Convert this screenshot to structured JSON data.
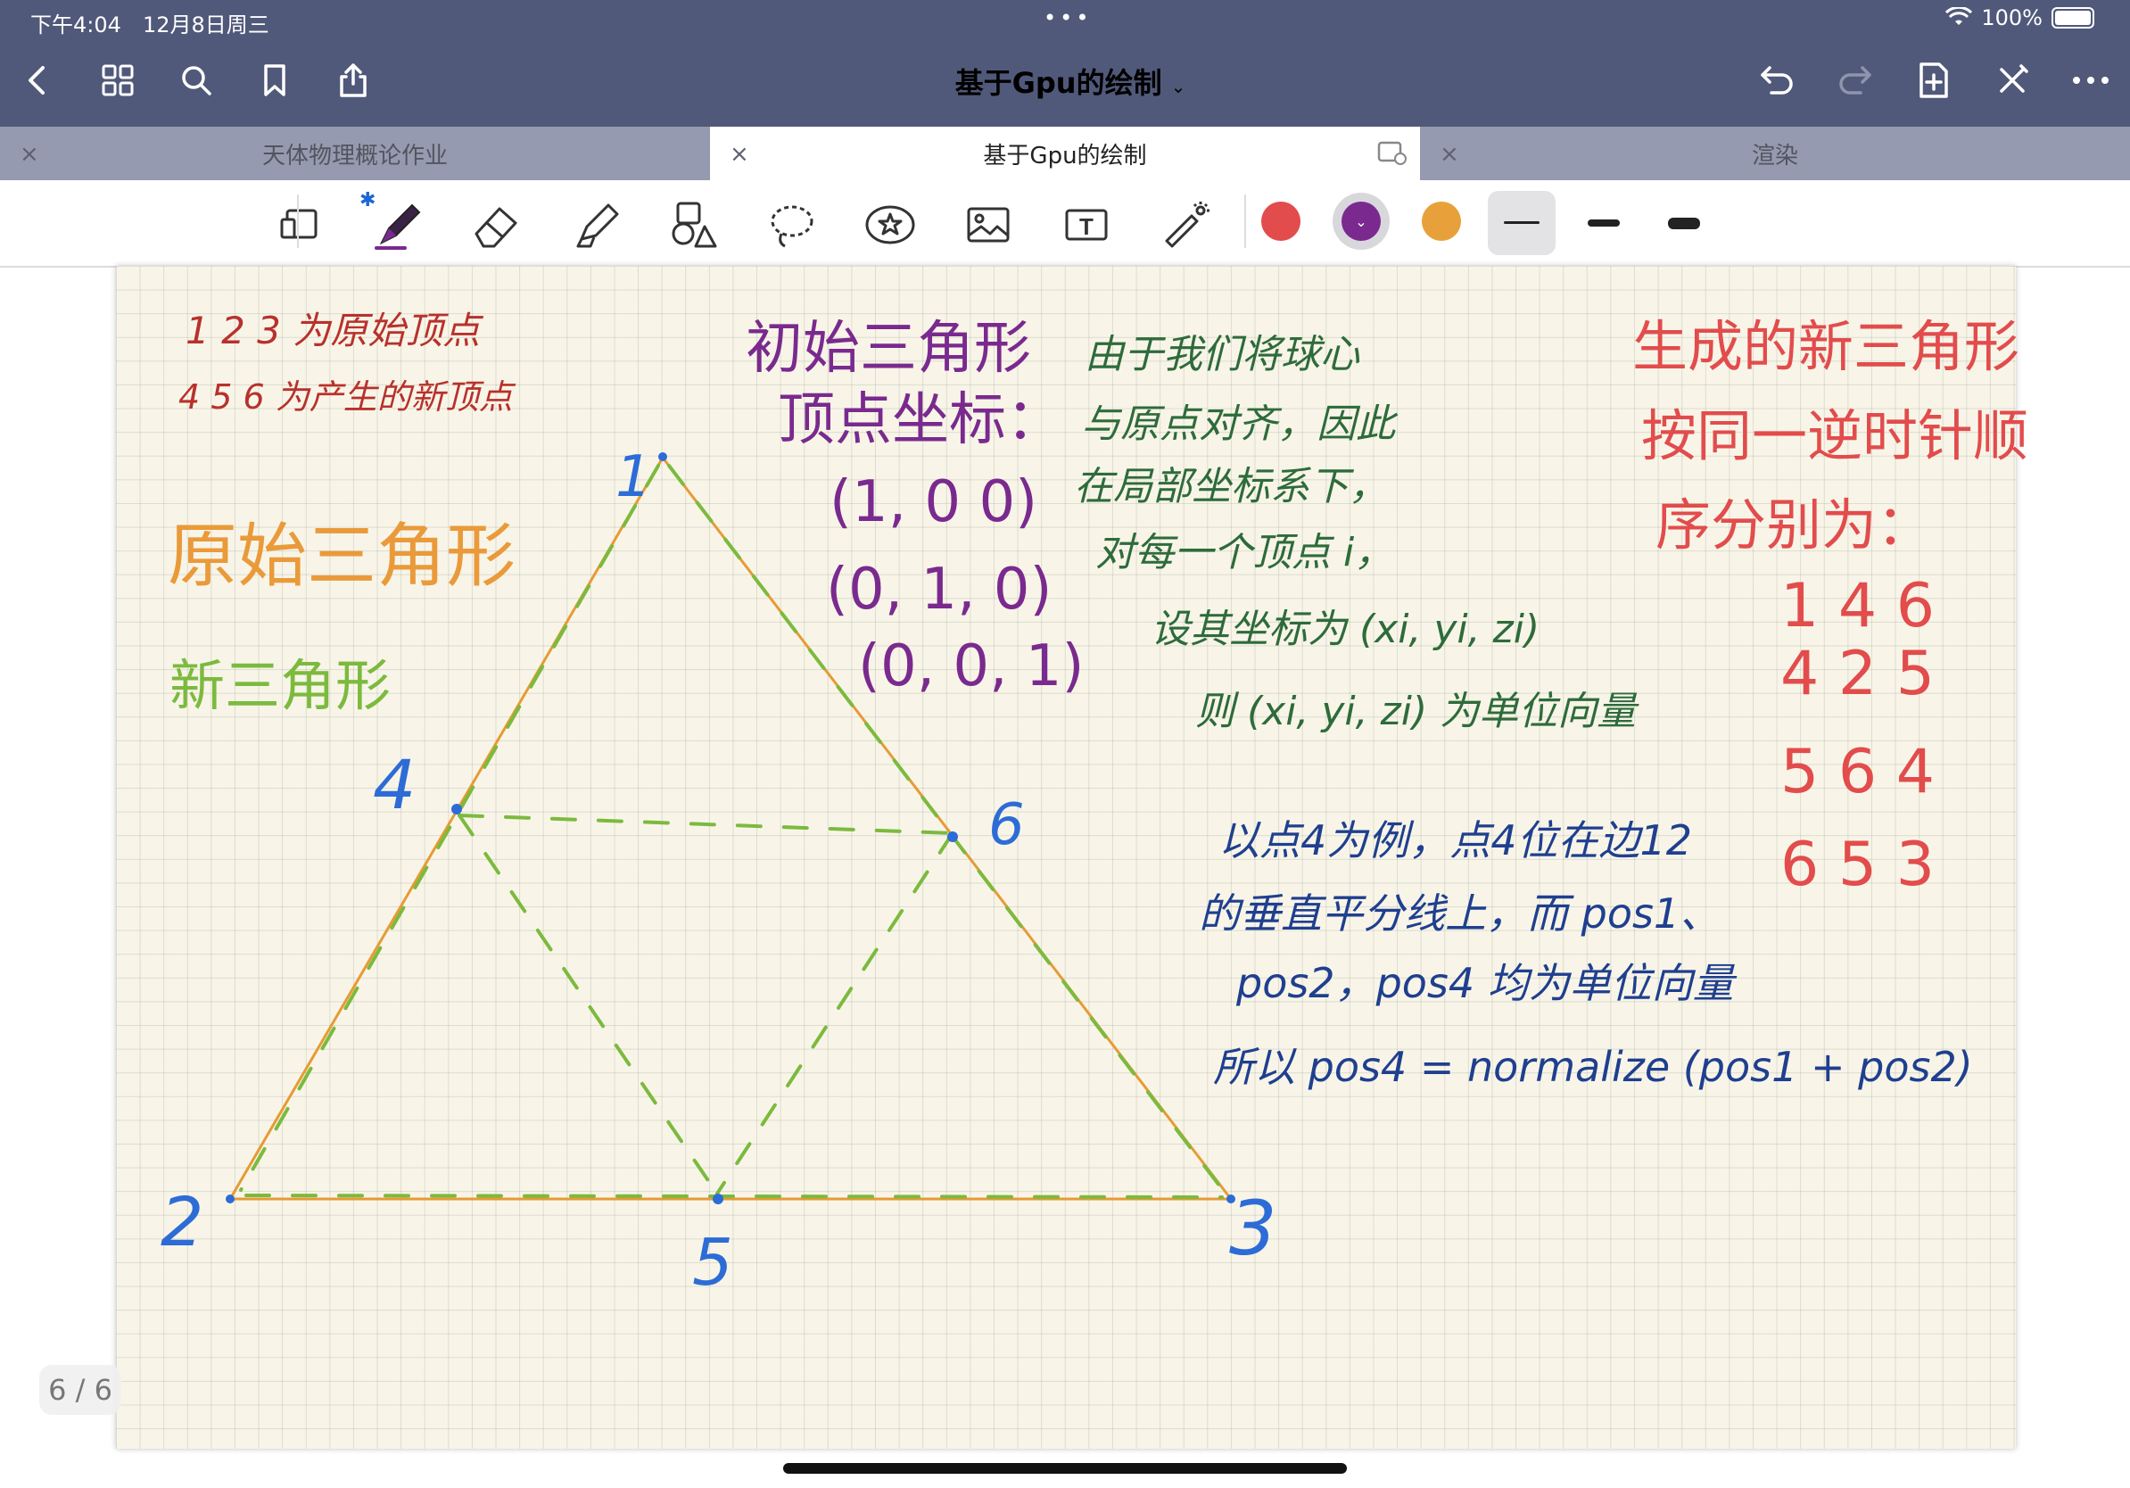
{
  "status_bar": {
    "time": "下午4:04",
    "date": "12月8日周三",
    "dots": "•••",
    "battery": "100%"
  },
  "nav_bar": {
    "title": "基于Gpu的绘制",
    "title_chevron": "⌄",
    "left_icons": [
      "back-icon",
      "grid-icon",
      "search-icon",
      "bookmark-icon",
      "share-icon"
    ],
    "right_icons": [
      "undo-icon",
      "redo-icon",
      "add-page-icon",
      "close-edit-icon",
      "more-icon"
    ]
  },
  "tabs": [
    {
      "label": "天体物理概论作业",
      "close": "×",
      "active": false
    },
    {
      "label": "基于Gpu的绘制",
      "close": "×",
      "active": true
    },
    {
      "label": "渲染",
      "close": "×",
      "active": false
    }
  ],
  "toolbar": {
    "tools": [
      "page-layout-icon",
      "pen-icon",
      "eraser-icon",
      "highlighter-icon",
      "shapes-icon",
      "lasso-icon",
      "sticker-icon",
      "image-icon",
      "text-icon",
      "laser-pointer-icon"
    ],
    "bluetooth_glyph": "✱",
    "text_tool_glyph": "T",
    "colors": [
      "#e24c4c",
      "#7a2a8e",
      "#e8a13a"
    ],
    "selected_color": "#7a2a8e",
    "selected_color_mark": "⌄",
    "thickness_selected": "thin"
  },
  "notes": {
    "legend_red": [
      "1 2 3 为原始顶点",
      "4 5 6 为产生的新顶点"
    ],
    "original_triangle": "原始三角形",
    "new_triangle": "新三角形",
    "initial_title": [
      "初始三角形",
      "顶点坐标："
    ],
    "coordinates": [
      "(1, 0 0)",
      "(0, 1, 0)",
      "(0, 0, 1)"
    ],
    "green_text": [
      "由于我们将球心",
      "与原点对齐，因此",
      "在局部坐标系下，",
      "对每一个顶点 i，",
      "设其坐标为 (xi, yi, zi)",
      "则 (xi, yi, zi) 为单位向量"
    ],
    "red_title": [
      "生成的新三角形",
      "按同一逆时针顺",
      "序分别为："
    ],
    "triangle_lists": [
      "1 4 6",
      "4 2 5",
      "5 6 4",
      "6 5 3"
    ],
    "blue_text": [
      "以点4为例，点4位在边12",
      "的垂直平分线上，而 pos1、",
      "pos2，pos4 均为单位向量",
      "所以 pos4 = normalize (pos1 + pos2)"
    ],
    "vertex_labels": [
      "1",
      "2",
      "3",
      "4",
      "5",
      "6"
    ]
  },
  "page_indicator": "6 / 6"
}
